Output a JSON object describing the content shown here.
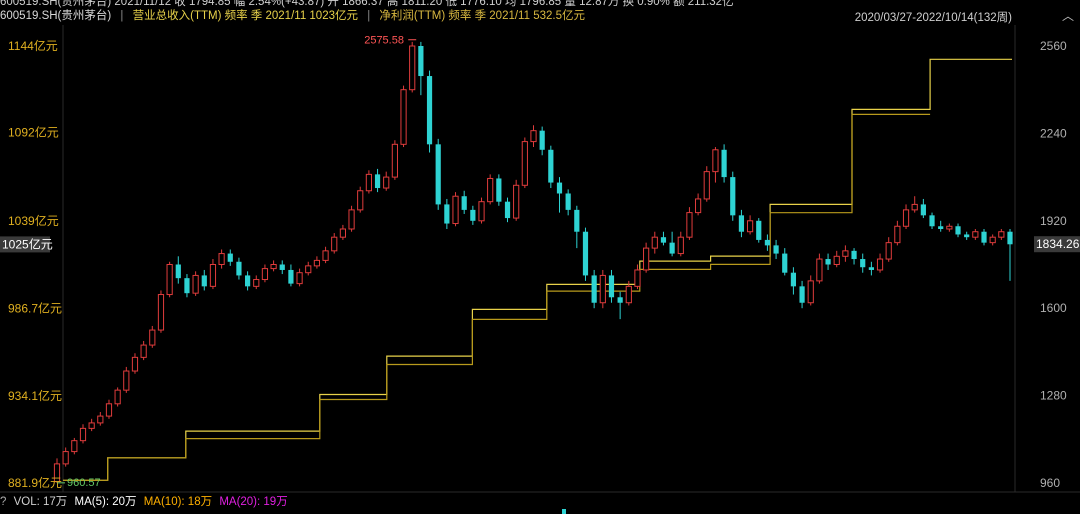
{
  "header": {
    "line1": "600519.SH(贵州茅台)  2021/11/12  收 1794.85  幅 2.54%(+43.87)  开 1866.37  高 1811.20  低 1776.10  均 1796.85  量 12.87万  换 0.90%  额 211.32亿",
    "symbol": "600519.SH(贵州茅台)",
    "revenue_label": "营业总收入(TTM) 频率 季 2021/11 1023亿元",
    "profit_label": "净利润(TTM) 频率 季 2021/11 532.5亿元",
    "range": "2020/03/27-2022/10/14(132周)"
  },
  "colors": {
    "background": "#000000",
    "up": "#e03c3c",
    "down": "#2ed3d3",
    "revenue_line": "#e8d24a",
    "profit_line": "#b89a1c",
    "left_axis_text": "#e0b020",
    "right_axis_text": "#b0b0b0",
    "ma5": "#ffffff",
    "ma10": "#ffb000",
    "ma20": "#e020e0"
  },
  "axes": {
    "left_ticks": [
      "1144亿元",
      "1092亿元",
      "1039亿元",
      "986.7亿元",
      "934.1亿元",
      "881.9亿元"
    ],
    "left_tick_values": [
      1144,
      1092,
      1039,
      986.7,
      934.1,
      881.9
    ],
    "left_current": "1025亿元",
    "right_ticks": [
      "2560",
      "2240",
      "1920",
      "1600",
      "1280",
      "960"
    ],
    "right_current": "1834.26",
    "max_label": "2575.58",
    "min_label": "960.57"
  },
  "volume": {
    "label": "VOL: 17万",
    "ma5": "MA(5): 20万",
    "ma10": "MA(10): 18万",
    "ma20": "MA(20): 19万"
  },
  "chart_data": [
    {
      "type": "line",
      "title": "",
      "series": [
        {
          "name": "营业总收入(TTM)",
          "axis": "left",
          "unit": "亿元",
          "points": [
            [
              0,
              883.5
            ],
            [
              12,
              883.5
            ],
            [
              12,
              897
            ],
            [
              33,
              897
            ],
            [
              33,
              913
            ],
            [
              69,
              913
            ],
            [
              69,
              935
            ],
            [
              87,
              935
            ],
            [
              87,
              958
            ],
            [
              110,
              958
            ],
            [
              110,
              986
            ],
            [
              130,
              986
            ],
            [
              130,
              1001
            ],
            [
              155,
              1001
            ],
            [
              155,
              1015
            ],
            [
              174,
              1015
            ],
            [
              174,
              1018
            ],
            [
              190,
              1018
            ],
            [
              190,
              1049
            ],
            [
              212,
              1049
            ],
            [
              212,
              1106
            ],
            [
              233,
              1106
            ],
            [
              233,
              1136
            ],
            [
              255,
              1136
            ]
          ]
        },
        {
          "name": "净利润(TTM)",
          "axis": "left",
          "unit": "亿元",
          "points": [
            [
              0,
              883.5
            ],
            [
              12,
              883.5
            ],
            [
              12,
              897
            ],
            [
              33,
              897
            ],
            [
              33,
              908.5
            ],
            [
              69,
              908.5
            ],
            [
              69,
              932
            ],
            [
              87,
              932
            ],
            [
              87,
              953
            ],
            [
              110,
              953
            ],
            [
              110,
              980
            ],
            [
              130,
              980
            ],
            [
              130,
              997
            ],
            [
              155,
              997
            ],
            [
              155,
              1010
            ],
            [
              174,
              1010
            ],
            [
              174,
              1013
            ],
            [
              190,
              1013
            ],
            [
              190,
              1044
            ],
            [
              212,
              1044
            ],
            [
              212,
              1103
            ],
            [
              233,
              1103
            ]
          ]
        }
      ]
    },
    {
      "type": "candlestick",
      "title": "",
      "unit": "price",
      "x_range": [
        0,
        255
      ],
      "y_axis": "right",
      "y_ticks": [
        960,
        1280,
        1600,
        1920,
        2240,
        2560
      ],
      "ohlc": [
        [
          965,
          1030,
          960,
          1050
        ],
        [
          1030,
          1075,
          1020,
          1090
        ],
        [
          1075,
          1115,
          1065,
          1125
        ],
        [
          1115,
          1160,
          1105,
          1175
        ],
        [
          1160,
          1180,
          1150,
          1195
        ],
        [
          1180,
          1205,
          1170,
          1220
        ],
        [
          1205,
          1250,
          1195,
          1265
        ],
        [
          1250,
          1300,
          1240,
          1310
        ],
        [
          1300,
          1370,
          1290,
          1385
        ],
        [
          1370,
          1420,
          1360,
          1435
        ],
        [
          1420,
          1465,
          1410,
          1480
        ],
        [
          1465,
          1520,
          1455,
          1535
        ],
        [
          1520,
          1650,
          1510,
          1665
        ],
        [
          1650,
          1760,
          1640,
          1770
        ],
        [
          1760,
          1710,
          1690,
          1790
        ],
        [
          1710,
          1655,
          1640,
          1725
        ],
        [
          1655,
          1720,
          1645,
          1735
        ],
        [
          1720,
          1680,
          1665,
          1740
        ],
        [
          1680,
          1760,
          1670,
          1780
        ],
        [
          1760,
          1800,
          1745,
          1815
        ],
        [
          1800,
          1770,
          1755,
          1815
        ],
        [
          1770,
          1720,
          1705,
          1785
        ],
        [
          1720,
          1680,
          1665,
          1735
        ],
        [
          1680,
          1705,
          1670,
          1720
        ],
        [
          1705,
          1745,
          1695,
          1760
        ],
        [
          1745,
          1760,
          1735,
          1775
        ],
        [
          1760,
          1740,
          1725,
          1775
        ],
        [
          1740,
          1690,
          1680,
          1760
        ],
        [
          1690,
          1730,
          1680,
          1745
        ],
        [
          1730,
          1755,
          1720,
          1770
        ],
        [
          1755,
          1775,
          1745,
          1790
        ],
        [
          1775,
          1810,
          1765,
          1825
        ],
        [
          1810,
          1860,
          1800,
          1875
        ],
        [
          1860,
          1890,
          1850,
          1905
        ],
        [
          1890,
          1960,
          1880,
          1975
        ],
        [
          1960,
          2030,
          1950,
          2045
        ],
        [
          2030,
          2090,
          2020,
          2105
        ],
        [
          2090,
          2040,
          2025,
          2110
        ],
        [
          2040,
          2080,
          2030,
          2100
        ],
        [
          2080,
          2200,
          2070,
          2215
        ],
        [
          2200,
          2400,
          2190,
          2415
        ],
        [
          2400,
          2560,
          2390,
          2575
        ],
        [
          2560,
          2450,
          2380,
          2575
        ],
        [
          2450,
          2200,
          2170,
          2470
        ],
        [
          2200,
          1980,
          1960,
          2220
        ],
        [
          1980,
          1910,
          1890,
          2000
        ],
        [
          1910,
          2010,
          1900,
          2025
        ],
        [
          2010,
          1960,
          1945,
          2030
        ],
        [
          1960,
          1920,
          1905,
          1975
        ],
        [
          1920,
          1990,
          1910,
          2005
        ],
        [
          1990,
          2075,
          1980,
          2090
        ],
        [
          2075,
          1990,
          1975,
          2090
        ],
        [
          1990,
          1930,
          1915,
          2005
        ],
        [
          1930,
          2050,
          1920,
          2070
        ],
        [
          2050,
          2210,
          2040,
          2225
        ],
        [
          2210,
          2250,
          2190,
          2270
        ],
        [
          2250,
          2180,
          2160,
          2265
        ],
        [
          2180,
          2060,
          2040,
          2195
        ],
        [
          2060,
          2020,
          1950,
          2080
        ],
        [
          2020,
          1960,
          1940,
          2035
        ],
        [
          1960,
          1880,
          1820,
          1975
        ],
        [
          1880,
          1720,
          1700,
          1895
        ],
        [
          1720,
          1620,
          1600,
          1740
        ],
        [
          1620,
          1720,
          1600,
          1740
        ],
        [
          1720,
          1640,
          1620,
          1740
        ],
        [
          1640,
          1620,
          1560,
          1660
        ],
        [
          1620,
          1680,
          1610,
          1700
        ],
        [
          1680,
          1740,
          1670,
          1760
        ],
        [
          1740,
          1820,
          1730,
          1840
        ],
        [
          1820,
          1860,
          1800,
          1880
        ],
        [
          1860,
          1840,
          1830,
          1880
        ],
        [
          1840,
          1800,
          1790,
          1880
        ],
        [
          1800,
          1860,
          1790,
          1880
        ],
        [
          1860,
          1950,
          1850,
          1970
        ],
        [
          1950,
          2000,
          1940,
          2020
        ],
        [
          2000,
          2100,
          1990,
          2120
        ],
        [
          2100,
          2180,
          2060,
          2190
        ],
        [
          2180,
          2080,
          2060,
          2200
        ],
        [
          2080,
          1940,
          1920,
          2100
        ],
        [
          1940,
          1880,
          1860,
          1960
        ],
        [
          1880,
          1920,
          1870,
          1940
        ],
        [
          1920,
          1850,
          1840,
          1930
        ],
        [
          1850,
          1830,
          1810,
          1870
        ],
        [
          1830,
          1800,
          1780,
          1850
        ],
        [
          1800,
          1730,
          1720,
          1820
        ],
        [
          1730,
          1680,
          1650,
          1750
        ],
        [
          1680,
          1620,
          1600,
          1700
        ],
        [
          1620,
          1700,
          1610,
          1720
        ],
        [
          1700,
          1780,
          1690,
          1800
        ],
        [
          1780,
          1760,
          1740,
          1800
        ],
        [
          1760,
          1790,
          1750,
          1810
        ],
        [
          1790,
          1810,
          1770,
          1830
        ],
        [
          1810,
          1780,
          1760,
          1820
        ],
        [
          1780,
          1750,
          1730,
          1800
        ],
        [
          1750,
          1740,
          1720,
          1770
        ],
        [
          1740,
          1780,
          1730,
          1800
        ],
        [
          1780,
          1840,
          1770,
          1860
        ],
        [
          1840,
          1900,
          1830,
          1920
        ],
        [
          1900,
          1960,
          1890,
          1980
        ],
        [
          1960,
          1980,
          1950,
          2010
        ],
        [
          1980,
          1940,
          1930,
          2000
        ],
        [
          1940,
          1900,
          1890,
          1950
        ],
        [
          1900,
          1890,
          1880,
          1920
        ],
        [
          1890,
          1900,
          1880,
          1910
        ],
        [
          1900,
          1870,
          1860,
          1910
        ],
        [
          1870,
          1860,
          1850,
          1880
        ],
        [
          1860,
          1880,
          1850,
          1890
        ],
        [
          1880,
          1840,
          1830,
          1890
        ],
        [
          1840,
          1860,
          1830,
          1870
        ],
        [
          1860,
          1880,
          1850,
          1890
        ],
        [
          1880,
          1834,
          1700,
          1890
        ]
      ]
    }
  ]
}
